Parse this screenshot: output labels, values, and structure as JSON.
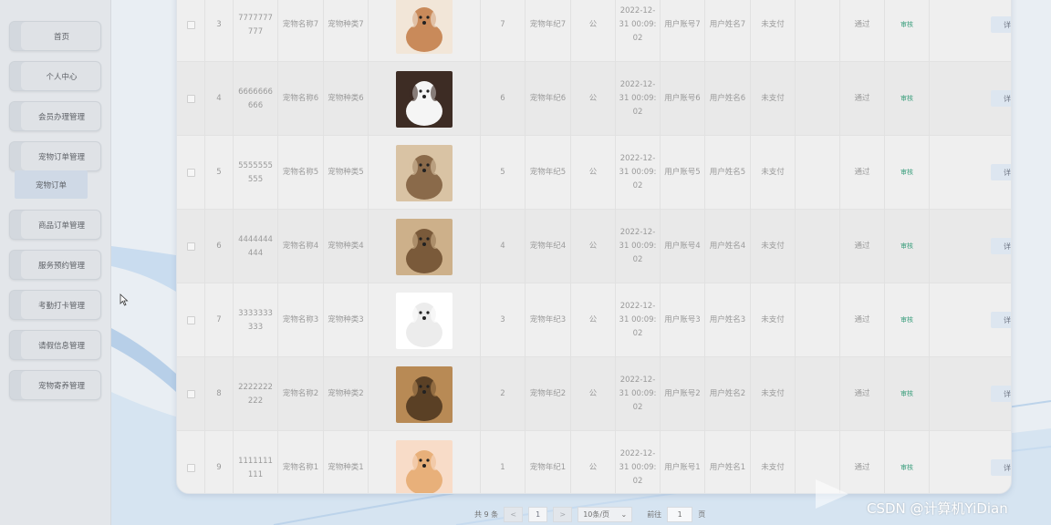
{
  "sidebar": {
    "items": [
      {
        "label": "首页"
      },
      {
        "label": "个人中心"
      },
      {
        "label": "会员办理管理"
      },
      {
        "label": "宠物订单管理"
      },
      {
        "label": "商品订单管理"
      },
      {
        "label": "服务预约管理"
      },
      {
        "label": "考勤打卡管理"
      },
      {
        "label": "请假信息管理"
      },
      {
        "label": "宠物寄养管理"
      }
    ],
    "sub_item": {
      "label": "宠物订单"
    }
  },
  "table": {
    "rows": [
      {
        "index": "3",
        "code": "7777777777",
        "pet_name": "宠物名称7",
        "pet_type": "宠物种类7",
        "image": "dog-photo-7",
        "age_num": "7",
        "pet_age": "宠物年纪7",
        "gender": "公",
        "date": "2022-12-31 00:09:02",
        "account": "用户账号7",
        "user_name": "用户姓名7",
        "pay_status": "未支付",
        "blank": "",
        "review": "通过",
        "audit": "审核",
        "detail": "详"
      },
      {
        "index": "4",
        "code": "6666666666",
        "pet_name": "宠物名称6",
        "pet_type": "宠物种类6",
        "image": "dog-photo-6",
        "age_num": "6",
        "pet_age": "宠物年纪6",
        "gender": "公",
        "date": "2022-12-31 00:09:02",
        "account": "用户账号6",
        "user_name": "用户姓名6",
        "pay_status": "未支付",
        "blank": "",
        "review": "通过",
        "audit": "审核",
        "detail": "详"
      },
      {
        "index": "5",
        "code": "5555555555",
        "pet_name": "宠物名称5",
        "pet_type": "宠物种类5",
        "image": "dog-photo-5",
        "age_num": "5",
        "pet_age": "宠物年纪5",
        "gender": "公",
        "date": "2022-12-31 00:09:02",
        "account": "用户账号5",
        "user_name": "用户姓名5",
        "pay_status": "未支付",
        "blank": "",
        "review": "通过",
        "audit": "审核",
        "detail": "详"
      },
      {
        "index": "6",
        "code": "4444444444",
        "pet_name": "宠物名称4",
        "pet_type": "宠物种类4",
        "image": "dog-photo-4",
        "age_num": "4",
        "pet_age": "宠物年纪4",
        "gender": "公",
        "date": "2022-12-31 00:09:02",
        "account": "用户账号4",
        "user_name": "用户姓名4",
        "pay_status": "未支付",
        "blank": "",
        "review": "通过",
        "audit": "审核",
        "detail": "详"
      },
      {
        "index": "7",
        "code": "3333333333",
        "pet_name": "宠物名称3",
        "pet_type": "宠物种类3",
        "image": "dog-photo-3",
        "age_num": "3",
        "pet_age": "宠物年纪3",
        "gender": "公",
        "date": "2022-12-31 00:09:02",
        "account": "用户账号3",
        "user_name": "用户姓名3",
        "pay_status": "未支付",
        "blank": "",
        "review": "通过",
        "audit": "审核",
        "detail": "详"
      },
      {
        "index": "8",
        "code": "2222222222",
        "pet_name": "宠物名称2",
        "pet_type": "宠物种类2",
        "image": "dog-photo-2",
        "age_num": "2",
        "pet_age": "宠物年纪2",
        "gender": "公",
        "date": "2022-12-31 00:09:02",
        "account": "用户账号2",
        "user_name": "用户姓名2",
        "pay_status": "未支付",
        "blank": "",
        "review": "通过",
        "audit": "审核",
        "detail": "详"
      },
      {
        "index": "9",
        "code": "1111111111",
        "pet_name": "宠物名称1",
        "pet_type": "宠物种类1",
        "image": "dog-photo-1",
        "age_num": "1",
        "pet_age": "宠物年纪1",
        "gender": "公",
        "date": "2022-12-31 00:09:02",
        "account": "用户账号1",
        "user_name": "用户姓名1",
        "pay_status": "未支付",
        "blank": "",
        "review": "通过",
        "audit": "审核",
        "detail": "详"
      }
    ]
  },
  "pagination": {
    "total": "共 9 条",
    "prev": "<",
    "page": "1",
    "next": ">",
    "page_size": "10条/页",
    "goto_label": "前往",
    "goto_value": "1",
    "page_suffix": "页"
  },
  "watermark": "CSDN @计算机YiDian",
  "colors": {
    "audit_link": "#3a9e7c",
    "card_bg": "#efefef",
    "sidebar_bg": "#e3e6ea"
  }
}
